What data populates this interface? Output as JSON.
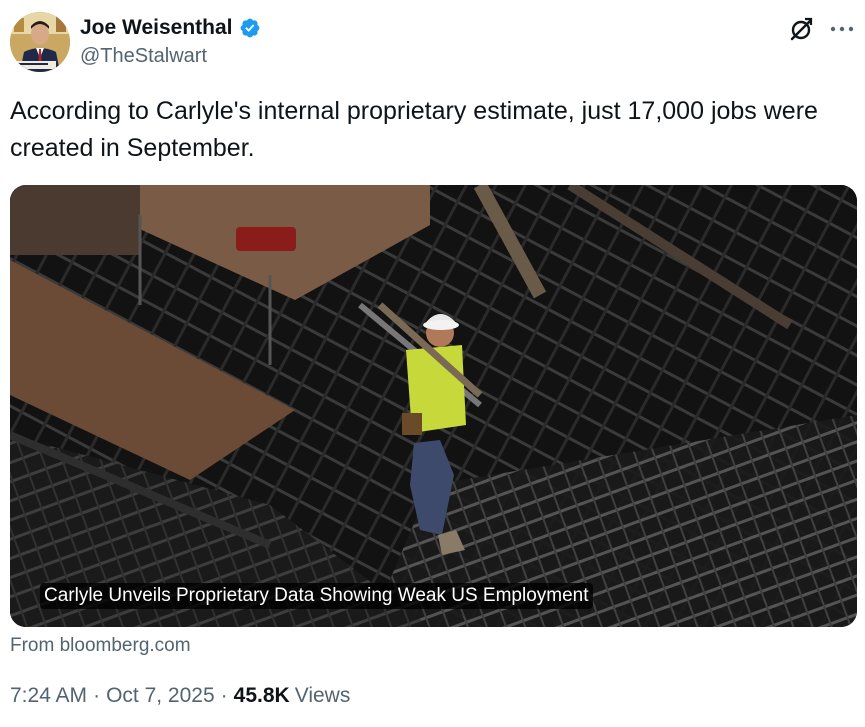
{
  "author": {
    "display_name": "Joe Weisenthal",
    "handle": "@TheStalwart",
    "verified": true,
    "avatar_icon": "profile-photo"
  },
  "actions": {
    "grok_icon": "grok-icon",
    "more_icon": "more-horizontal-icon"
  },
  "tweet": {
    "text": "According to Carlyle's internal proprietary estimate, just 17,000 jobs were created in September."
  },
  "link_card": {
    "title": "Carlyle Unveils Proprietary Data Showing Weak US Employment",
    "source": "From bloomberg.com"
  },
  "meta": {
    "time": "7:24 AM",
    "separator": "·",
    "date": "Oct 7, 2025",
    "views_count": "45.8K",
    "views_label": "Views"
  },
  "colors": {
    "text_primary": "#0f1419",
    "text_secondary": "#536471",
    "verified_blue": "#1d9bf0"
  }
}
